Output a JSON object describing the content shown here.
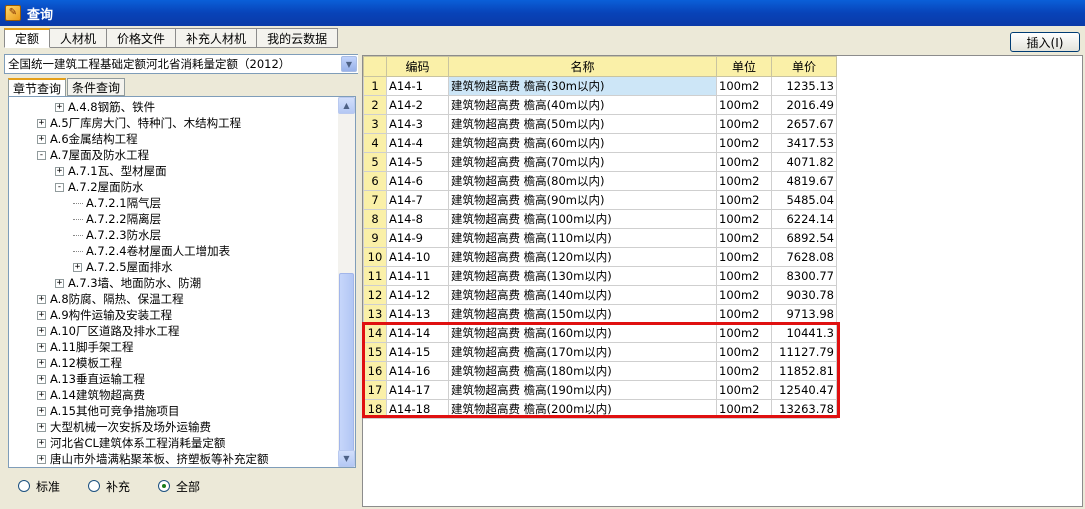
{
  "window": {
    "title": "查询"
  },
  "top_tabs": [
    "定额",
    "人材机",
    "价格文件",
    "补充人材机",
    "我的云数据"
  ],
  "active_top_tab": 0,
  "insert_button": "插入(I)",
  "combo": {
    "value": "全国统一建筑工程基础定额河北省消耗量定额（2012）"
  },
  "sub_tabs": [
    "章节查询",
    "条件查询"
  ],
  "tree": [
    {
      "label": "A.4.8钢筋、铁件",
      "level": 1,
      "expander": "+"
    },
    {
      "label": "A.5厂库房大门、特种门、木结构工程",
      "level": 0,
      "expander": "+"
    },
    {
      "label": "A.6金属结构工程",
      "level": 0,
      "expander": "+"
    },
    {
      "label": "A.7屋面及防水工程",
      "level": 0,
      "expander": "-"
    },
    {
      "label": "A.7.1瓦、型材屋面",
      "level": 1,
      "expander": "+"
    },
    {
      "label": "A.7.2屋面防水",
      "level": 1,
      "expander": "-"
    },
    {
      "label": "A.7.2.1隔气层",
      "level": 2,
      "expander": ""
    },
    {
      "label": "A.7.2.2隔离层",
      "level": 2,
      "expander": ""
    },
    {
      "label": "A.7.2.3防水层",
      "level": 2,
      "expander": ""
    },
    {
      "label": "A.7.2.4卷材屋面人工增加表",
      "level": 2,
      "expander": ""
    },
    {
      "label": "A.7.2.5屋面排水",
      "level": 2,
      "expander": "+"
    },
    {
      "label": "A.7.3墙、地面防水、防潮",
      "level": 1,
      "expander": "+"
    },
    {
      "label": "A.8防腐、隔热、保温工程",
      "level": 0,
      "expander": "+"
    },
    {
      "label": "A.9构件运输及安装工程",
      "level": 0,
      "expander": "+"
    },
    {
      "label": "A.10厂区道路及排水工程",
      "level": 0,
      "expander": "+"
    },
    {
      "label": "A.11脚手架工程",
      "level": 0,
      "expander": "+"
    },
    {
      "label": "A.12模板工程",
      "level": 0,
      "expander": "+"
    },
    {
      "label": "A.13垂直运输工程",
      "level": 0,
      "expander": "+"
    },
    {
      "label": "A.14建筑物超高费",
      "level": 0,
      "expander": "+"
    },
    {
      "label": "A.15其他可竞争措施项目",
      "level": 0,
      "expander": "+"
    },
    {
      "label": "大型机械一次安拆及场外运输费",
      "level": 0,
      "expander": "+"
    },
    {
      "label": "河北省CL建筑体系工程消耗量定额",
      "level": 0,
      "expander": "+"
    },
    {
      "label": "唐山市外墙满粘聚苯板、挤塑板等补充定额",
      "level": 0,
      "expander": "+"
    }
  ],
  "radios": [
    {
      "label": "标准",
      "checked": false
    },
    {
      "label": "补充",
      "checked": false
    },
    {
      "label": "全部",
      "checked": true
    }
  ],
  "grid": {
    "headers": [
      "",
      "编码",
      "名称",
      "单位",
      "单价"
    ],
    "rows": [
      {
        "n": "1",
        "code": "A14-1",
        "name": "建筑物超高费 檐高(30m以内)",
        "unit": "100m2",
        "price": "1235.13"
      },
      {
        "n": "2",
        "code": "A14-2",
        "name": "建筑物超高费 檐高(40m以内)",
        "unit": "100m2",
        "price": "2016.49"
      },
      {
        "n": "3",
        "code": "A14-3",
        "name": "建筑物超高费 檐高(50m以内)",
        "unit": "100m2",
        "price": "2657.67"
      },
      {
        "n": "4",
        "code": "A14-4",
        "name": "建筑物超高费 檐高(60m以内)",
        "unit": "100m2",
        "price": "3417.53"
      },
      {
        "n": "5",
        "code": "A14-5",
        "name": "建筑物超高费 檐高(70m以内)",
        "unit": "100m2",
        "price": "4071.82"
      },
      {
        "n": "6",
        "code": "A14-6",
        "name": "建筑物超高费 檐高(80m以内)",
        "unit": "100m2",
        "price": "4819.67"
      },
      {
        "n": "7",
        "code": "A14-7",
        "name": "建筑物超高费 檐高(90m以内)",
        "unit": "100m2",
        "price": "5485.04"
      },
      {
        "n": "8",
        "code": "A14-8",
        "name": "建筑物超高费 檐高(100m以内)",
        "unit": "100m2",
        "price": "6224.14"
      },
      {
        "n": "9",
        "code": "A14-9",
        "name": "建筑物超高费 檐高(110m以内)",
        "unit": "100m2",
        "price": "6892.54"
      },
      {
        "n": "10",
        "code": "A14-10",
        "name": "建筑物超高费 檐高(120m以内)",
        "unit": "100m2",
        "price": "7628.08"
      },
      {
        "n": "11",
        "code": "A14-11",
        "name": "建筑物超高费 檐高(130m以内)",
        "unit": "100m2",
        "price": "8300.77"
      },
      {
        "n": "12",
        "code": "A14-12",
        "name": "建筑物超高费 檐高(140m以内)",
        "unit": "100m2",
        "price": "9030.78"
      },
      {
        "n": "13",
        "code": "A14-13",
        "name": "建筑物超高费 檐高(150m以内)",
        "unit": "100m2",
        "price": "9713.98"
      },
      {
        "n": "14",
        "code": "A14-14",
        "name": "建筑物超高费 檐高(160m以内)",
        "unit": "100m2",
        "price": "10441.3"
      },
      {
        "n": "15",
        "code": "A14-15",
        "name": "建筑物超高费 檐高(170m以内)",
        "unit": "100m2",
        "price": "11127.79"
      },
      {
        "n": "16",
        "code": "A14-16",
        "name": "建筑物超高费 檐高(180m以内)",
        "unit": "100m2",
        "price": "11852.81"
      },
      {
        "n": "17",
        "code": "A14-17",
        "name": "建筑物超高费 檐高(190m以内)",
        "unit": "100m2",
        "price": "12540.47"
      },
      {
        "n": "18",
        "code": "A14-18",
        "name": "建筑物超高费 檐高(200m以内)",
        "unit": "100m2",
        "price": "13263.78"
      }
    ]
  },
  "colors": {
    "title_bar": "#0843b8",
    "header_bg": "#faf0a8",
    "selected_cell": "#cde6f7",
    "highlight_box": "#e01010"
  }
}
